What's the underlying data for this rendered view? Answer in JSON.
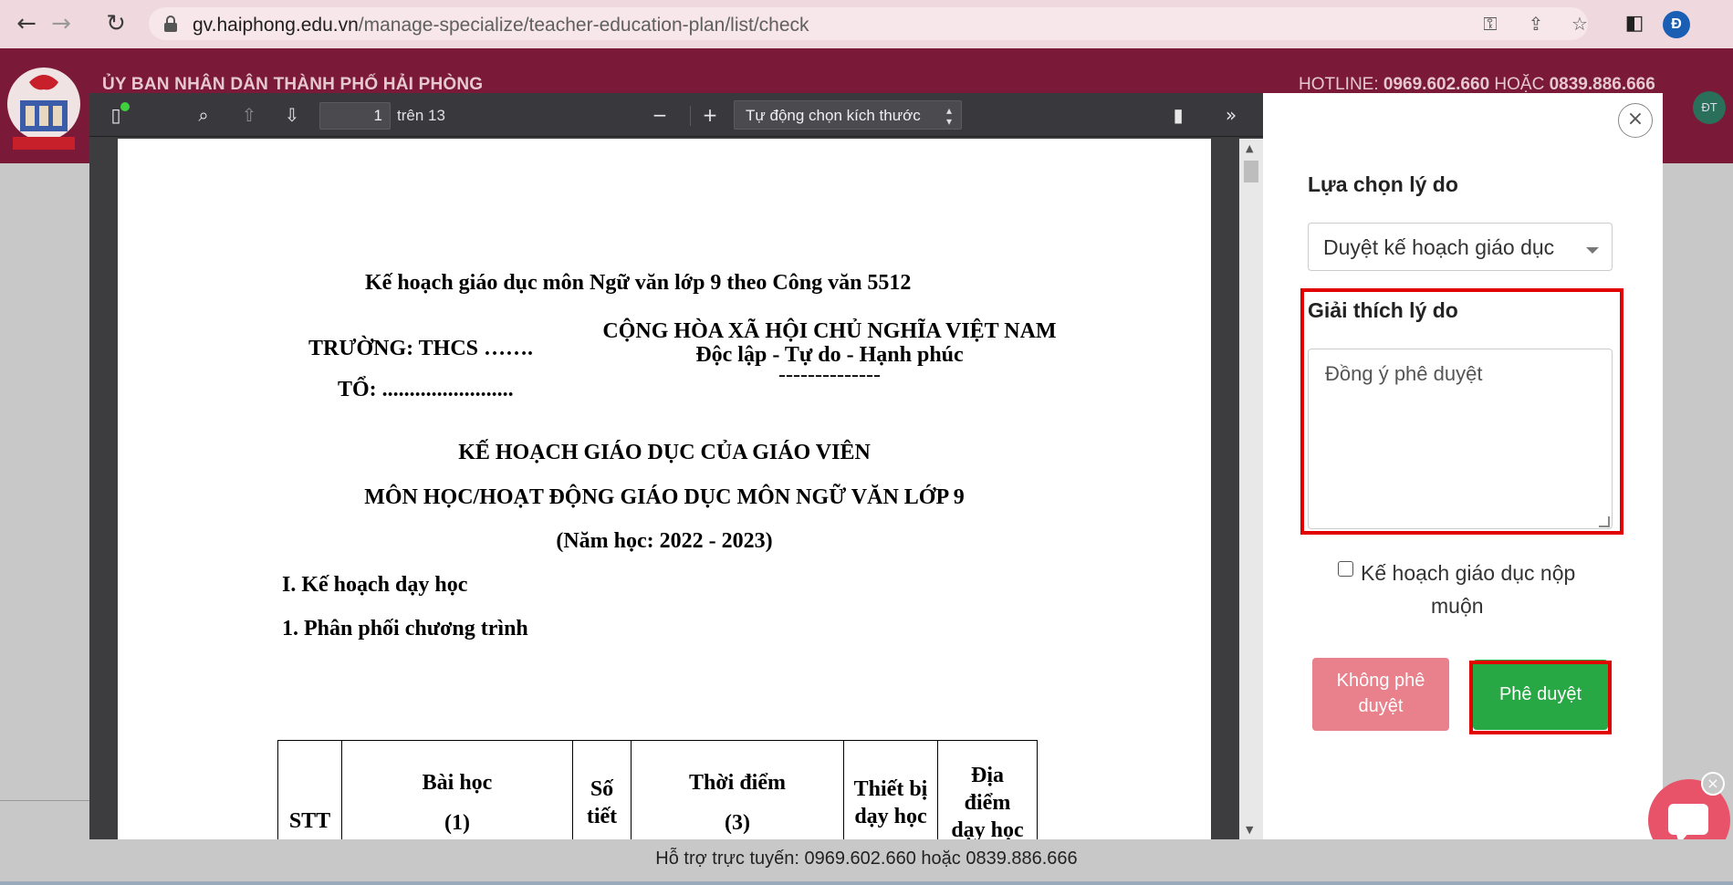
{
  "browser": {
    "url_host": "gv.haiphong.edu.vn",
    "url_path": "/manage-specialize/teacher-education-plan/list/check",
    "profile_initial": "Đ",
    "icons": [
      "back-icon",
      "forward-icon",
      "reload-icon",
      "lock-icon",
      "key-icon",
      "share-icon",
      "star-icon",
      "side-panel-icon"
    ]
  },
  "site": {
    "title": "ỦY BAN NHÂN DÂN THÀNH PHỐ HẢI PHÒNG",
    "hotline_label": "HOTLINE: ",
    "hotline_1": "0969.602.660",
    "hotline_or": " HOẶC ",
    "hotline_2": "0839.886.666",
    "user_initials": "ĐT"
  },
  "pdf_viewer": {
    "page_number": "1",
    "page_of": "trên 13",
    "zoom_label": "Tự động chọn kích thước"
  },
  "document": {
    "title": "Kế hoạch giáo dục môn Ngữ văn lớp 9 theo Công văn 5512",
    "school": "TRƯỜNG: THCS …….",
    "group": "TỔ: ........................",
    "republic": "CỘNG HÒA XÃ HỘI CHỦ NGHĨA VIỆT NAM",
    "motto": "Độc lập - Tự do - Hạnh phúc",
    "dashes": "--------------",
    "heading1": "KẾ HOẠCH GIÁO DỤC CỦA GIÁO VIÊN",
    "heading2": "MÔN HỌC/HOẠT ĐỘNG GIÁO DỤC MÔN NGỮ VĂN LỚP 9",
    "school_year": "(Năm học: 2022 - 2023)",
    "section1": "I. Kế hoạch dạy học",
    "subsection1": "1. Phân phối chương trình",
    "table_headers": {
      "stt": "STT",
      "lesson": "Bài học",
      "lesson_num": "(1)",
      "periods_1": "Số",
      "periods_2": "tiết",
      "time": "Thời điểm",
      "time_num": "(3)",
      "equipment_1": "Thiết bị",
      "equipment_2": "dạy học",
      "location_1": "Địa",
      "location_2": "điểm",
      "location_3": "dạy học"
    }
  },
  "panel": {
    "reason_label": "Lựa chọn lý do",
    "reason_value": "Duyệt kế hoạch giáo dục",
    "explain_label": "Giải thích lý do",
    "explain_value": "Đồng ý phê duyệt",
    "late_checkbox_line1": "Kế hoạch giáo dục nộp",
    "late_checkbox_line2": "muộn",
    "reject_line1": "Không phê",
    "reject_line2": "duyệt",
    "approve_label": "Phê duyệt",
    "highlight_color": "#e00000",
    "approve_color": "#28a745",
    "reject_color": "#e8818b"
  },
  "footer": {
    "support_text": "Hỗ trợ trực tuyến: 0969.602.660 hoặc 0839.886.666"
  }
}
